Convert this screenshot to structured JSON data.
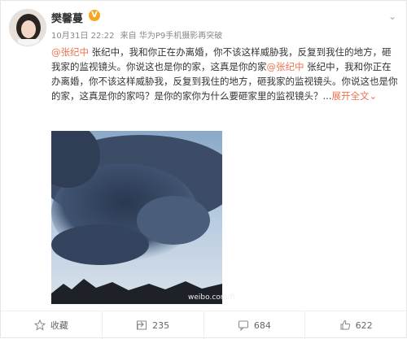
{
  "post": {
    "author": "樊馨蔓",
    "timestamp": "10月31日 22:22",
    "source": "来自 华为P9手机摄影再突破",
    "content_segments": [
      {
        "type": "mention",
        "text": "@张纪中"
      },
      {
        "type": "text",
        "text": "  张纪中，我和你正在办离婚，你不该这样威胁我，反复到我住的地方，砸我家的监视镜头。你说这也是你的家，这真是你的家"
      },
      {
        "type": "mention",
        "text": "@张纪中"
      },
      {
        "type": "text",
        "text": "  张纪中，我和你正在办离婚，你不该这样威胁我，反复到我住的地方，砸我家的监视镜头。你说这也是你的家，这真是你的家吗？是你的家你为什么要砸家里的监视镜头？..."
      },
      {
        "type": "more",
        "text": "展开全文"
      },
      {
        "type": "chevron",
        "text": "⌄"
      }
    ],
    "watermark": "weibo.com/fl"
  },
  "actions": [
    {
      "label": "收藏",
      "icon": "star-icon"
    },
    {
      "label": "235",
      "icon": "share-icon"
    },
    {
      "label": "684",
      "icon": "comment-icon"
    },
    {
      "label": "622",
      "icon": "like-icon"
    }
  ],
  "colors": {
    "accent": "#eb7350",
    "vip": "#f5a623"
  }
}
